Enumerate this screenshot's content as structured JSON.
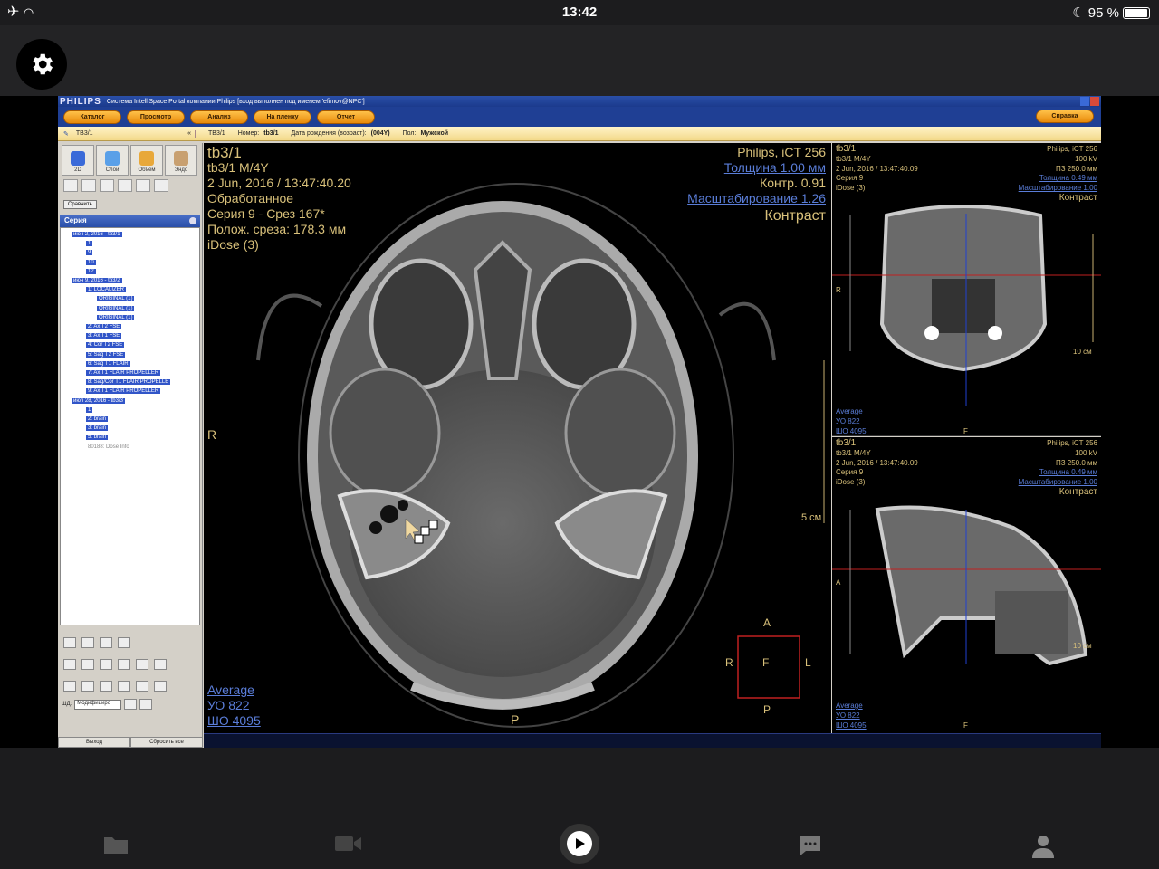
{
  "status": {
    "time": "13:42",
    "battery": "95 %",
    "battery_level": 0.95
  },
  "app": {
    "logo": "PHILIPS",
    "title": "Система IntelliSpace Portal компании Philips [вход выполнен под именем 'efimov@NPC']",
    "menu": [
      "Каталог",
      "Просмотр",
      "Анализ",
      "На пленку",
      "Отчет"
    ],
    "help": "Справка",
    "patient_id": "ТВ3/1",
    "info": {
      "id": "TB3/1",
      "number_label": "Номер:",
      "number": "tb3/1",
      "dob_label": "Дата рождения (возраст):",
      "dob": "(004Y)",
      "sex_label": "Пол:",
      "sex": "Мужской"
    },
    "tools": [
      "2D",
      "Слой",
      "Объем",
      "Эндо"
    ],
    "compare": "Сравнить",
    "series_header": "Серия",
    "tree": [
      "июн 2, 2016 - tb3/1",
      "1",
      "9",
      "10",
      "12",
      "июн 9, 2016 - tb3/2",
      "1: LOCALIZER",
      "ORIGINAL (1)",
      "ORIGINAL (1)",
      "ORIGINAL (1)",
      "2: Ax T2 FSE",
      "3: Ax T1 FSE",
      "4: Cor T2 FSE",
      "5: Sag T2 FSE",
      "6: Sag T1 FLAIR",
      "7: Ax T1 FLAIR PROPELLER",
      "8: Sag/Cor T1 FLAIR PROPELLE",
      "9: Ax T1 FLAIR PROPELLER",
      "июл 28, 2016 - tb3/3",
      "1",
      "2: brain",
      "3: brain",
      "5: brain",
      "80188: Dose Info"
    ],
    "shd_label": "ШД:",
    "shd_value": "Модифициро",
    "exit": "Выход",
    "reset": "Сбросить все"
  },
  "main": {
    "tl": [
      "tb3/1",
      "tb3/1 M/4Y",
      "2 Jun, 2016 / 13:47:40.20",
      "Обработанное",
      "Серия 9 - Срез 167*",
      "Полож. среза: 178.3 мм",
      "iDose (3)"
    ],
    "tr_scanner": "Philips, iCT 256",
    "tr_thickness": "Толщина 1.00 мм",
    "tr_contrast": "Контр. 0.91",
    "tr_scale": "Масштабирование 1.26",
    "tr_mode": "Контраст",
    "orient_r": "R",
    "orient_p": "P",
    "scale_label": "5 см",
    "bl": [
      "Average",
      "УО   822",
      "ШО  4095"
    ],
    "cube": {
      "a": "A",
      "r": "R",
      "f": "F",
      "l": "L",
      "p": "P"
    }
  },
  "side_top": {
    "tl": [
      "tb3/1",
      "tb3/1 M/4Y",
      "2 Jun, 2016 / 13:47:40.09",
      "Серия 9",
      "iDose (3)"
    ],
    "tr": [
      "Philips, iCT 256",
      "100 kV",
      "ПЗ 250.0 мм",
      "Толщина 0.49 мм",
      "Масштабирование 1.00",
      "Контраст"
    ],
    "r": "R",
    "scale": "10 см",
    "f": "F",
    "bl": [
      "Average",
      "УО   822",
      "ШО  4095"
    ]
  },
  "side_bottom": {
    "tl": [
      "tb3/1",
      "tb3/1 M/4Y",
      "2 Jun, 2016 / 13:47:40.09",
      "Серия 9",
      "iDose (3)"
    ],
    "tr": [
      "Philips, iCT 256",
      "100 kV",
      "ПЗ 250.0 мм",
      "Толщина 0.49 мм",
      "Масштабирование 1.00",
      "Контраст"
    ],
    "a": "A",
    "scale": "10 см",
    "f": "F",
    "bl": [
      "Average",
      "УО   822",
      "ШО  4095"
    ]
  },
  "colors": {
    "overlay": "#d8c07a",
    "link": "#5a7dd8",
    "crosshair_red": "#c02020",
    "crosshair_blue": "#2040d0"
  }
}
